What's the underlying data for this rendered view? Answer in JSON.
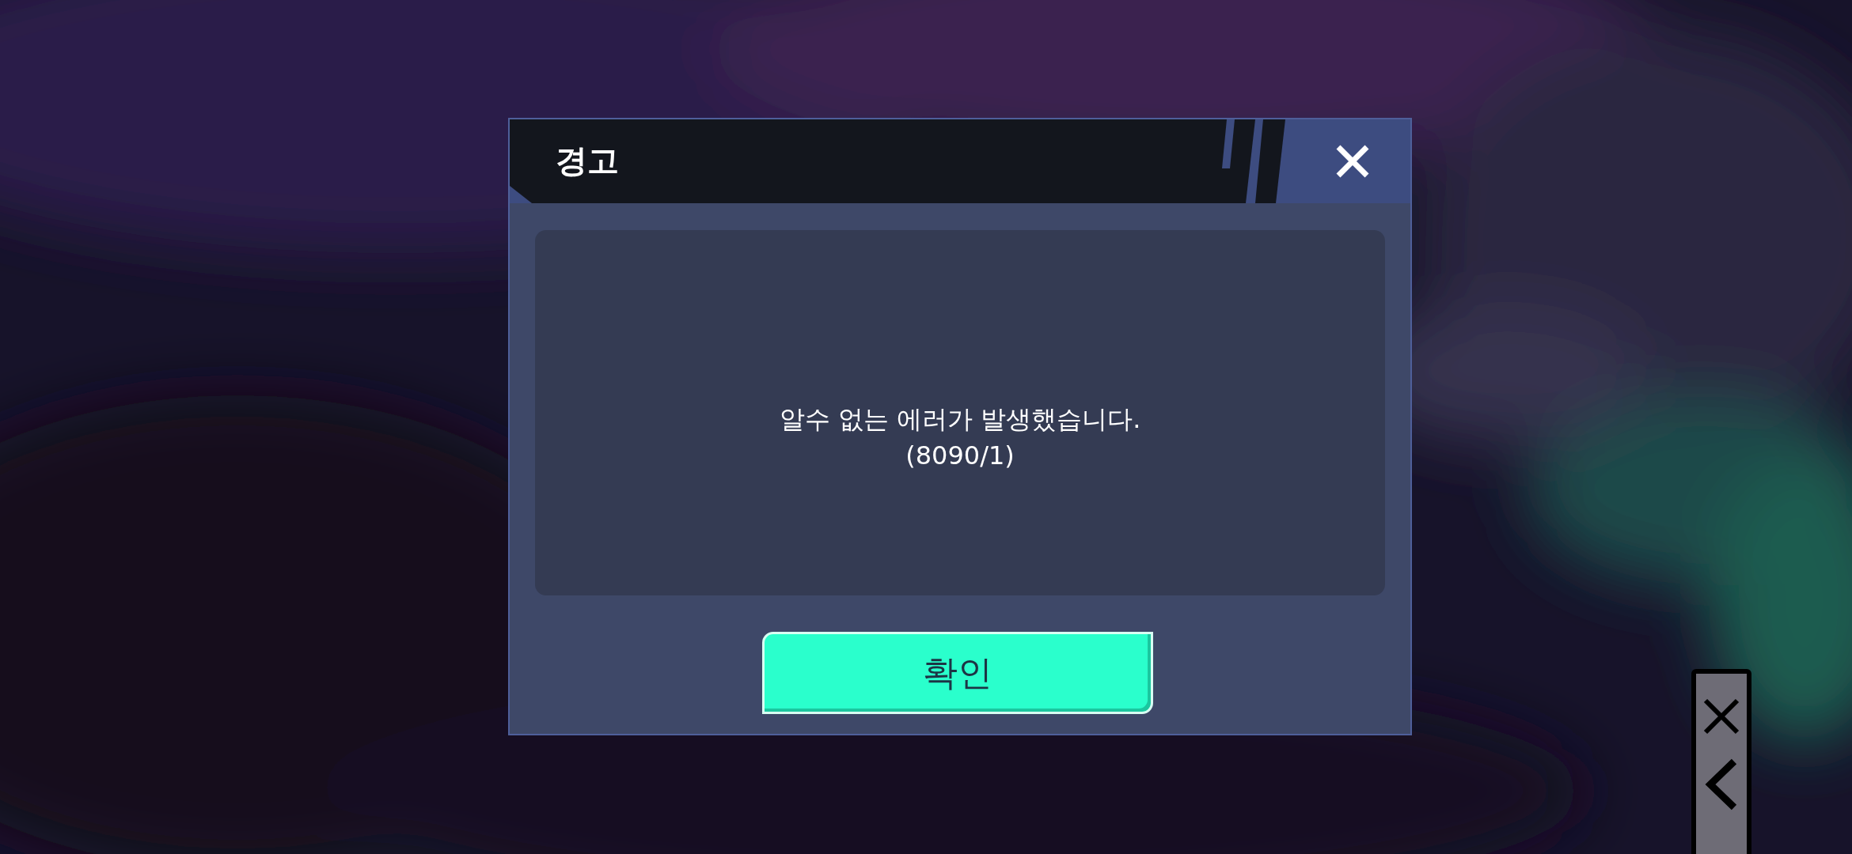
{
  "dialog": {
    "title": "경고",
    "message_lines": [
      "알수 없는 에러가 발생했습니다.",
      "(8090/1)"
    ],
    "confirm_button": "확인"
  },
  "side_controls": [
    {
      "kind": "close"
    },
    {
      "kind": "back"
    }
  ]
}
